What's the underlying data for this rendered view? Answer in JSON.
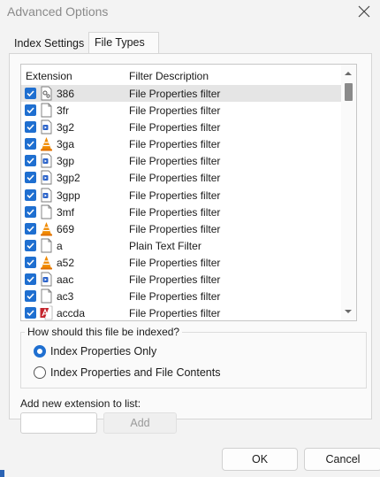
{
  "window": {
    "title": "Advanced Options"
  },
  "tabs": [
    {
      "label": "Index Settings",
      "active": false
    },
    {
      "label": "File Types",
      "active": true
    }
  ],
  "list": {
    "columns": [
      "Extension",
      "Filter Description"
    ],
    "rows": [
      {
        "ext": "386",
        "desc": "File Properties filter",
        "icon": "system-file-icon",
        "checked": true,
        "selected": true
      },
      {
        "ext": "3fr",
        "desc": "File Properties filter",
        "icon": "blank-file-icon",
        "checked": true
      },
      {
        "ext": "3g2",
        "desc": "File Properties filter",
        "icon": "video-file-icon",
        "checked": true
      },
      {
        "ext": "3ga",
        "desc": "File Properties filter",
        "icon": "vlc-cone-icon",
        "checked": true
      },
      {
        "ext": "3gp",
        "desc": "File Properties filter",
        "icon": "video-file-icon",
        "checked": true
      },
      {
        "ext": "3gp2",
        "desc": "File Properties filter",
        "icon": "video-file-icon",
        "checked": true
      },
      {
        "ext": "3gpp",
        "desc": "File Properties filter",
        "icon": "video-file-icon",
        "checked": true
      },
      {
        "ext": "3mf",
        "desc": "File Properties filter",
        "icon": "blank-file-icon",
        "checked": true
      },
      {
        "ext": "669",
        "desc": "File Properties filter",
        "icon": "vlc-cone-icon",
        "checked": true
      },
      {
        "ext": "a",
        "desc": "Plain Text Filter",
        "icon": "blank-file-icon",
        "checked": true
      },
      {
        "ext": "a52",
        "desc": "File Properties filter",
        "icon": "vlc-cone-icon",
        "checked": true
      },
      {
        "ext": "aac",
        "desc": "File Properties filter",
        "icon": "video-file-icon",
        "checked": true
      },
      {
        "ext": "ac3",
        "desc": "File Properties filter",
        "icon": "blank-file-icon",
        "checked": true
      },
      {
        "ext": "accda",
        "desc": "File Properties filter",
        "icon": "access-file-icon",
        "checked": true
      }
    ]
  },
  "index_group": {
    "legend": "How should this file be indexed?",
    "options": [
      {
        "label": "Index Properties Only",
        "selected": true
      },
      {
        "label": "Index Properties and File Contents",
        "selected": false
      }
    ]
  },
  "add": {
    "label": "Add new extension to list:",
    "input_value": "",
    "button_label": "Add",
    "button_enabled": false
  },
  "footer": {
    "ok_label": "OK",
    "cancel_label": "Cancel"
  },
  "colors": {
    "accent": "#1f6fd0",
    "selected_row": "#e5e5e5",
    "vlc_orange": "#f08a00",
    "access_red": "#c4262e"
  }
}
